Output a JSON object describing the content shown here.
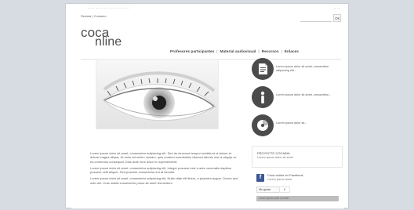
{
  "colors": {
    "page_bg": "#d7dbe2",
    "frame_bg": "#ffffff",
    "logo_text": "#4f4f4f",
    "icon_circle": "#4b4b4b",
    "fb_blue": "#3b5998"
  },
  "topline": {
    "left_text": "— — — — — — — — — — —",
    "right_text": "— —"
  },
  "toolbar": {
    "links": [
      "Revista",
      "| Contacto"
    ],
    "search": {
      "placeholder": "",
      "button_label": "Ok"
    }
  },
  "header": {
    "logo_line1": "coca",
    "logo_line2": "nline",
    "nav": [
      {
        "label": "Profesores participantes"
      },
      {
        "label": "Material audiovisual"
      },
      {
        "label": "Recursos"
      },
      {
        "label": "Enlaces"
      }
    ]
  },
  "promos": [
    {
      "icon": "document-icon",
      "text": "Lorem ipsum dolor sit amet, consectetur adipiscing elit..."
    },
    {
      "icon": "info-icon",
      "text": "Lorem ipsum dolor sit amet, consectetur..."
    },
    {
      "icon": "chart-icon",
      "text": "Lorem ipsum dolor sit..."
    }
  ],
  "box": {
    "title": "PROYECTO COCAINA",
    "sub": "Lorem ipsum dolor sit amet"
  },
  "fb": {
    "title": "Coca-online en Facebook",
    "sub": "Lorem ipsum dolor",
    "like_label": "Me gusta",
    "count": "0",
    "bar_label": "Lorem ipsum dolor sit amet"
  },
  "main_text": [
    "Lorem ipsum dolor sit amet, consectetur adipiscing elit. Sed do eiusmod tempor incididunt ut labore et dolore magna aliqua. Ut enim ad minim veniam, quis nostrud exercitation ullamco laboris nisi ut aliquip ex ea commodo consequat. Duis aute irure dolor in reprehenderit.",
    "Lorem ipsum dolor sit amet, consectetur adipiscing elit. Integer posuere erat a ante venenatis dapibus posuere velit aliquet. Sed posuere consectetur est at lobortis.",
    "Lorem ipsum dolor sit amet, consectetur adipiscing elit. Nulla vitae elit libero, a pharetra augue. Donec sed odio dui. Cras mattis consectetur purus sit amet fermentum."
  ]
}
